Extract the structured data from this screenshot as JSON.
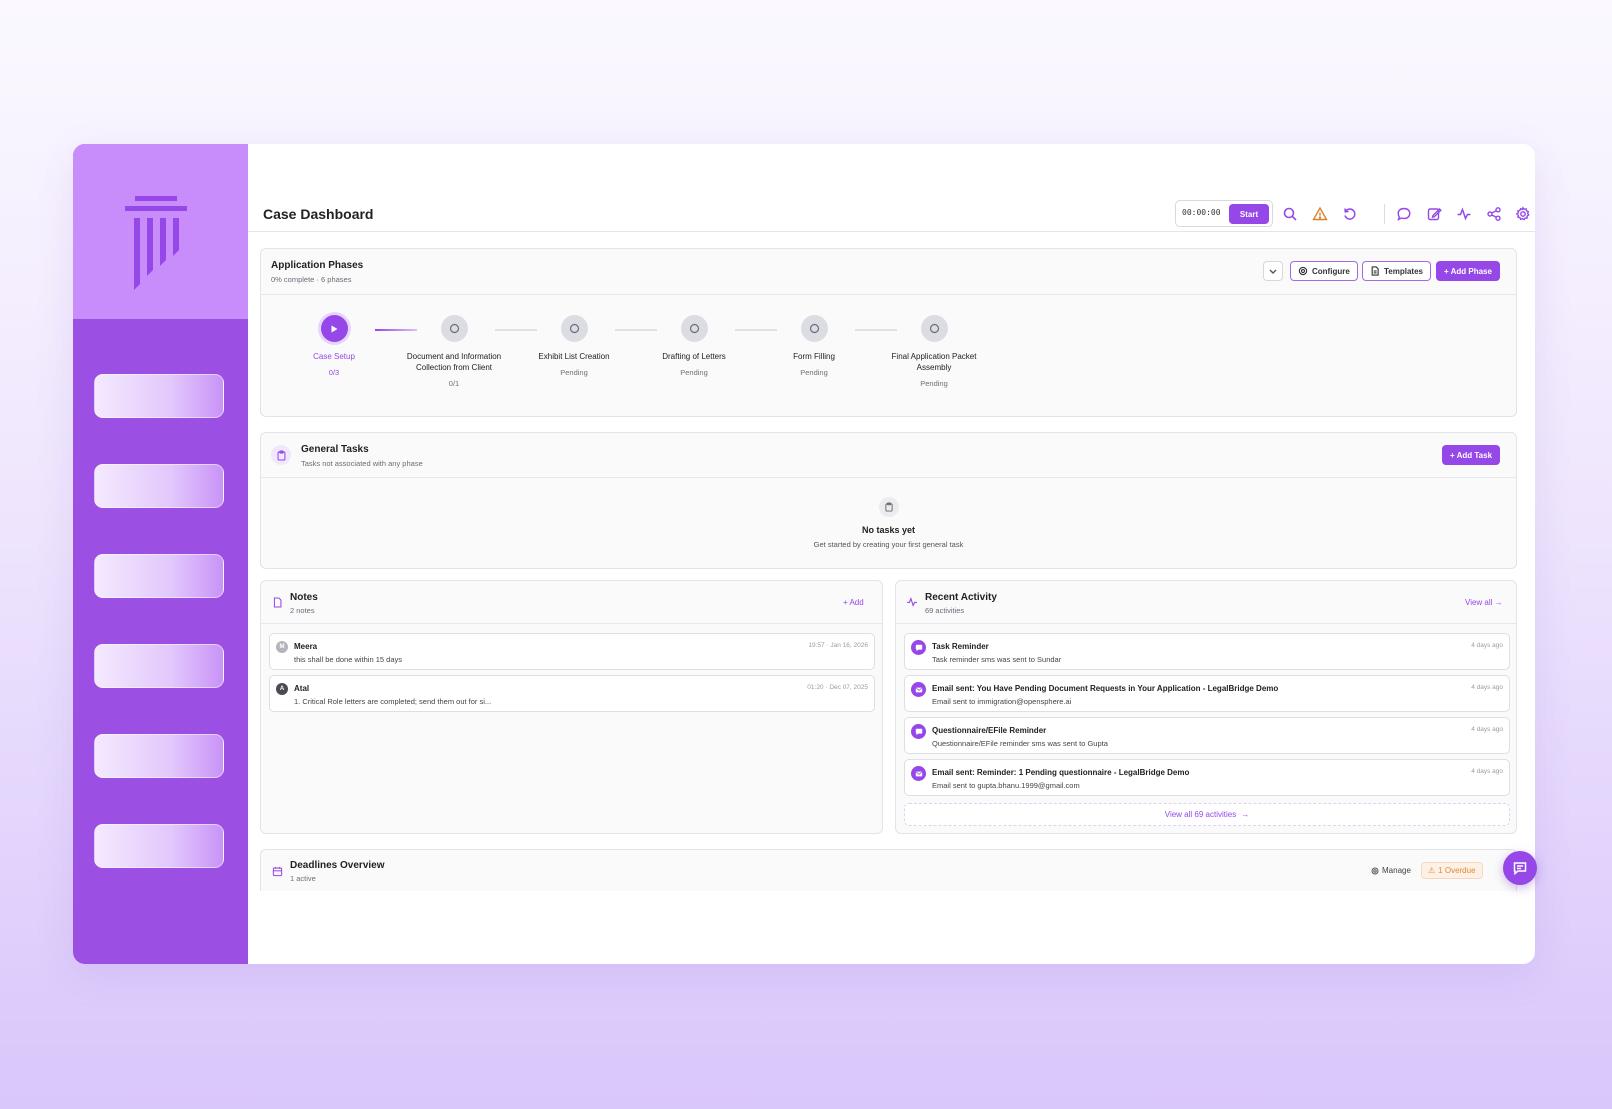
{
  "header": {
    "title": "Case Dashboard",
    "timer": "00:00:00",
    "start_label": "Start"
  },
  "phases_card": {
    "title": "Application Phases",
    "subtitle": "0% complete · 6 phases",
    "configure_label": "Configure",
    "templates_label": "Templates",
    "add_phase_label": "+ Add Phase",
    "phases": [
      {
        "name": "Case Setup",
        "status": "0/3"
      },
      {
        "name": "Document and Information Collection from Client",
        "status": "0/1"
      },
      {
        "name": "Exhibit List Creation",
        "status": "Pending"
      },
      {
        "name": "Drafting of Letters",
        "status": "Pending"
      },
      {
        "name": "Form Filling",
        "status": "Pending"
      },
      {
        "name": "Final Application Packet Assembly",
        "status": "Pending"
      }
    ]
  },
  "tasks_card": {
    "title": "General Tasks",
    "subtitle": "Tasks not associated with any phase",
    "add_task_label": "+ Add Task",
    "empty_title": "No tasks yet",
    "empty_subtitle": "Get started by creating your first general task"
  },
  "notes_card": {
    "title": "Notes",
    "subtitle": "2 notes",
    "add_label": "+ Add",
    "notes": [
      {
        "initial": "M",
        "author": "Meera",
        "time": "19:57 · Jan 16, 2026",
        "text": "this shall be done within 15 days"
      },
      {
        "initial": "A",
        "author": "Atal",
        "time": "01:20 · Dec 07, 2025",
        "text": "1. Critical Role letters are completed; send them out for si..."
      }
    ]
  },
  "activity_card": {
    "title": "Recent Activity",
    "subtitle": "69 activities",
    "view_all_label": "View all →",
    "view_all_footer": "View all 69 activities",
    "items": [
      {
        "icon": "chat-icon",
        "title": "Task Reminder",
        "text": "Task reminder sms was sent to Sundar",
        "time": "4 days ago"
      },
      {
        "icon": "mail-icon",
        "title": "Email sent: You Have Pending Document Requests in Your Application - LegalBridge Demo",
        "text": "Email sent to immigration@opensphere.ai",
        "time": "4 days ago"
      },
      {
        "icon": "chat-icon",
        "title": "Questionnaire/EFile Reminder",
        "text": "Questionnaire/EFile reminder sms was sent to Gupta",
        "time": "4 days ago"
      },
      {
        "icon": "mail-icon",
        "title": "Email sent: Reminder: 1 Pending questionnaire - LegalBridge Demo",
        "text": "Email sent to gupta.bhanu.1999@gmail.com",
        "time": "4 days ago"
      }
    ]
  },
  "deadlines_card": {
    "title": "Deadlines Overview",
    "subtitle": "1 active",
    "manage_label": "Manage",
    "overdue_label": "1 Overdue"
  },
  "colors": {
    "accent": "#9547e8",
    "sidebar": "#9b50e3",
    "sidebar_logo": "#c98dfb"
  }
}
